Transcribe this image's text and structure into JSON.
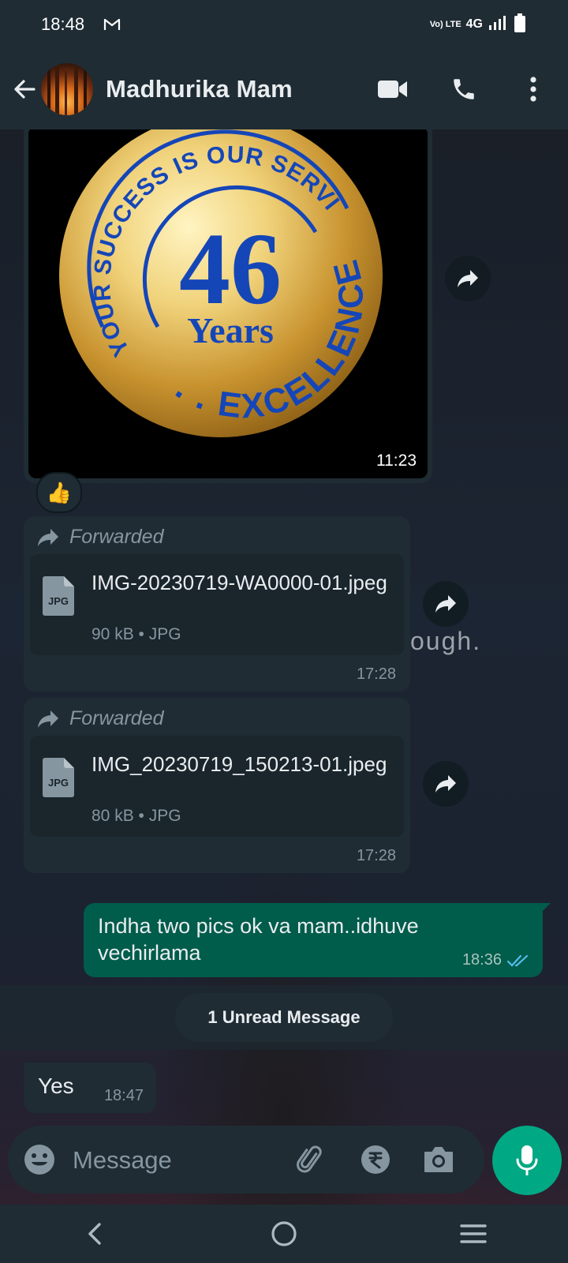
{
  "status_bar": {
    "time": "18:48",
    "volte": "Vo) LTE",
    "network": "4G",
    "icons": [
      "gmail-icon",
      "signal-icon",
      "battery-icon"
    ]
  },
  "header": {
    "contact_name": "Madhurika Mam",
    "icons": [
      "back-arrow-icon",
      "video-call-icon",
      "phone-icon",
      "more-options-icon"
    ]
  },
  "messages": {
    "image": {
      "time": "11:23",
      "reaction": "👍",
      "logo_text": {
        "arc_top": "YOUR SUCCESS IS OUR SERVICE",
        "number": "46",
        "word": "Years",
        "arc_bottom": ". . EXCELLENCE"
      }
    },
    "doc1": {
      "forwarded_label": "Forwarded",
      "file_type_icon": "JPG",
      "filename": "IMG-20230719-WA0000-01.jpeg",
      "meta": "90 kB • JPG",
      "time": "17:28"
    },
    "doc2": {
      "forwarded_label": "Forwarded",
      "file_type_icon": "JPG",
      "filename": "IMG_20230719_150213-01.jpeg",
      "meta": "80 kB • JPG",
      "time": "17:28"
    },
    "outgoing": {
      "text": "Indha two pics ok va mam..idhuve vechirlama",
      "time": "18:36",
      "status": "read"
    },
    "unread_banner": "1 Unread Message",
    "incoming": {
      "text": "Yes",
      "time": "18:47"
    }
  },
  "wallpaper_text": "ough.",
  "composer": {
    "placeholder": "Message",
    "icons": [
      "emoji-icon",
      "attach-icon",
      "rupee-payment-icon",
      "camera-icon",
      "mic-icon"
    ]
  },
  "nav_bar": {
    "icons": [
      "nav-back-icon",
      "nav-home-icon",
      "nav-recents-icon"
    ]
  },
  "colors": {
    "bar": "#1f2c34",
    "outgoing_bubble": "#005c4b",
    "accent": "#00a884",
    "read_ticks": "#53bdeb"
  }
}
